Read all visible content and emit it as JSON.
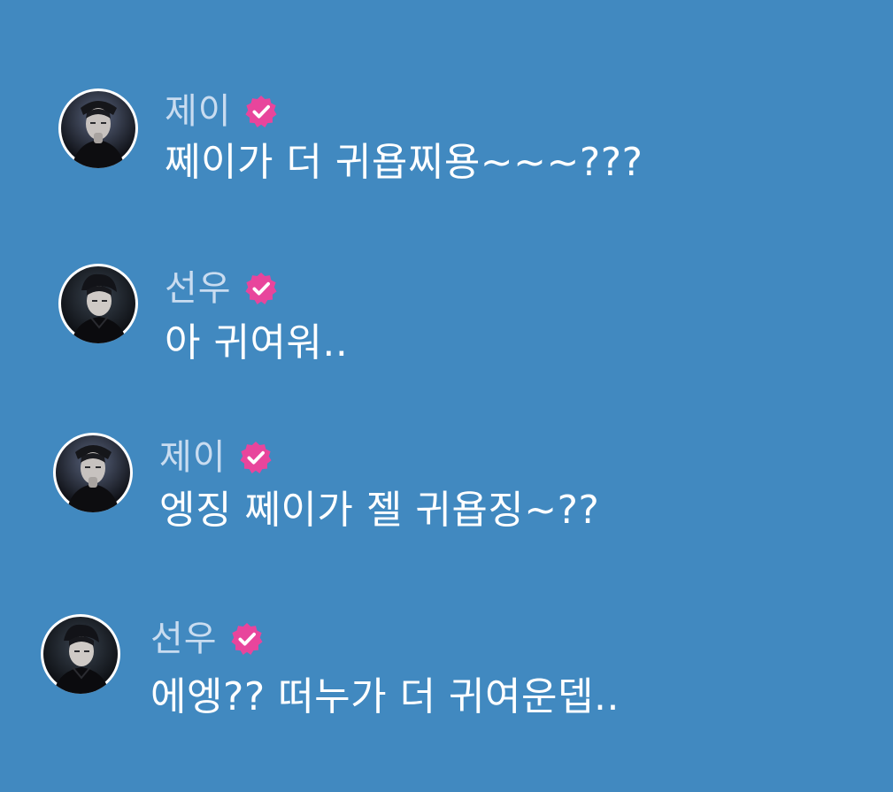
{
  "colors": {
    "background": "#4189c0",
    "text": "#ffffff",
    "name": "#c9dcf0",
    "badge": "#e8459c",
    "avatar_ring": "#ffffff"
  },
  "messages": [
    {
      "name": "제이",
      "text": "쩨이가 더 귀욥찌용~~~???",
      "avatar_icon": "avatar-jay",
      "badge_icon": "verified-badge-icon"
    },
    {
      "name": "선우",
      "text": "아 귀여워..",
      "avatar_icon": "avatar-sunoo",
      "badge_icon": "verified-badge-icon"
    },
    {
      "name": "제이",
      "text": "엥징 쩨이가 젤 귀욥징~??",
      "avatar_icon": "avatar-jay",
      "badge_icon": "verified-badge-icon"
    },
    {
      "name": "선우",
      "text": "에엥?? 떠누가 더 귀여운뎁..",
      "avatar_icon": "avatar-sunoo",
      "badge_icon": "verified-badge-icon"
    }
  ]
}
